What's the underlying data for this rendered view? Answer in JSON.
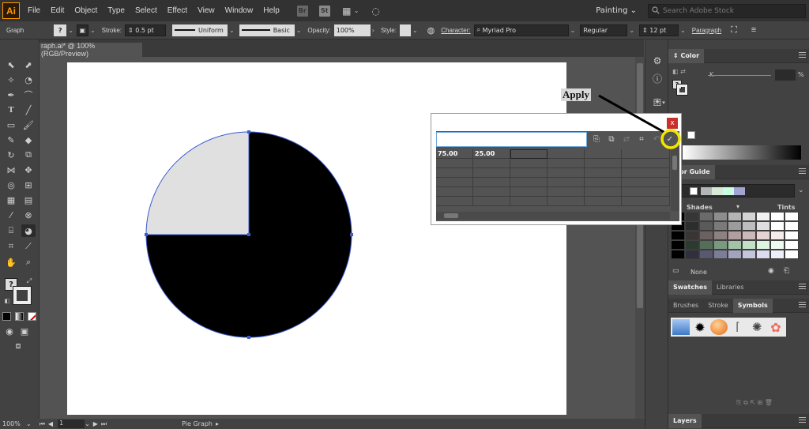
{
  "menubar": {
    "logo": "Ai",
    "items": [
      "File",
      "Edit",
      "Object",
      "Type",
      "Select",
      "Effect",
      "View",
      "Window",
      "Help"
    ],
    "bridge_icon": "Br",
    "stock_icon": "St",
    "workspace": "Painting",
    "search_placeholder": "Search Adobe Stock"
  },
  "controlbar": {
    "tool_name": "Graph",
    "stroke_label": "Stroke:",
    "stroke_value": "0.5 pt",
    "uniform_label": "Uniform",
    "basic_label": "Basic",
    "opacity_label": "Opacity:",
    "opacity_value": "100%",
    "style_label": "Style:",
    "character_label": "Character:",
    "font_name": "Myriad Pro",
    "font_style": "Regular",
    "font_size": "12 pt",
    "paragraph_label": "Paragraph"
  },
  "document": {
    "tab_title": "raph.ai* @ 100% (RGB/Preview)"
  },
  "statusbar": {
    "zoom": "100%",
    "page": "1",
    "current_tool": "Pie Graph"
  },
  "color_panel": {
    "title": "Color",
    "k_label": "K",
    "percent": "%"
  },
  "color_guide": {
    "title": "olor Guide",
    "shades_label": "Shades",
    "tints_label": "Tints",
    "none_label": "None"
  },
  "swatches_tabs": [
    "Swatches",
    "Libraries"
  ],
  "brushes_tabs": [
    "Brushes",
    "Stroke",
    "Symbols"
  ],
  "layers_title": "Layers",
  "dialog": {
    "close_label": "x",
    "row1": [
      "75.00",
      "25.00"
    ]
  },
  "annotation": {
    "apply_label": "Apply",
    "highlight_color": "#f2e500"
  },
  "chart_data": {
    "type": "pie",
    "values": [
      75,
      25
    ],
    "colors": [
      "#000000",
      "#e0e0e0"
    ]
  }
}
